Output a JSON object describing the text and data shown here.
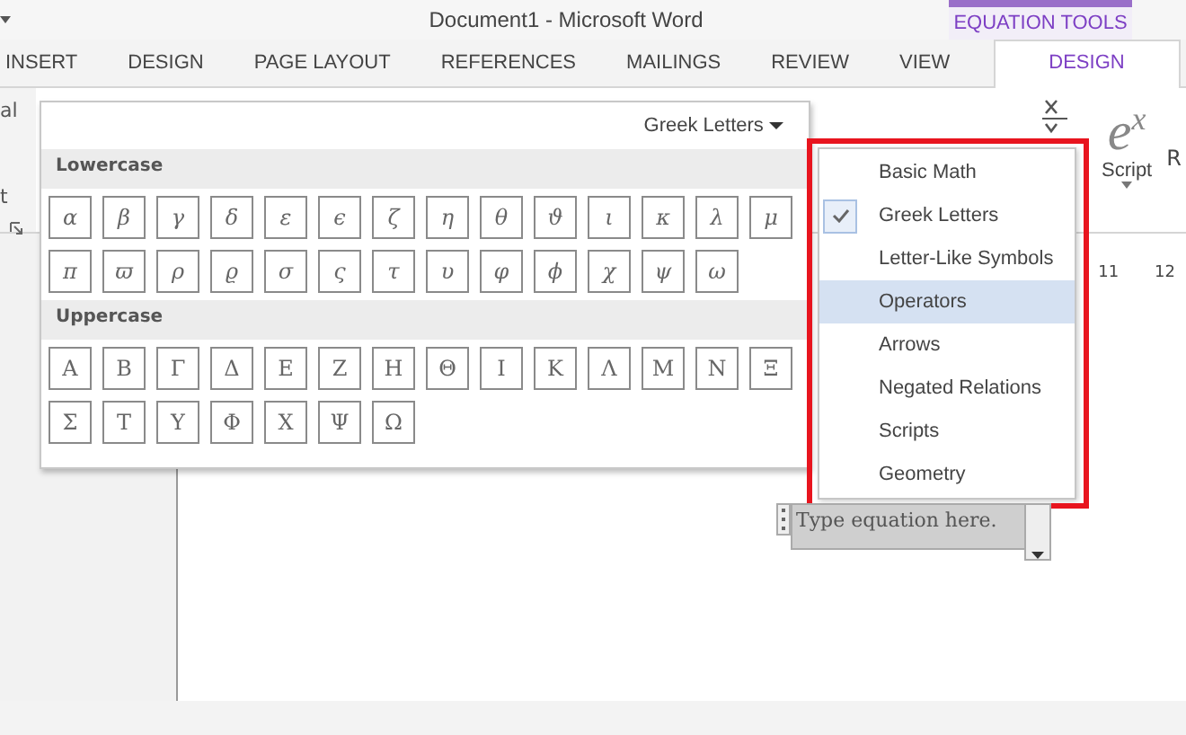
{
  "window": {
    "title": "Document1 - Microsoft Word",
    "context_tab_group": "EQUATION TOOLS"
  },
  "tabs": [
    {
      "label": "INSERT",
      "selected": false
    },
    {
      "label": "DESIGN",
      "selected": false
    },
    {
      "label": "PAGE LAYOUT",
      "selected": false
    },
    {
      "label": "REFERENCES",
      "selected": false
    },
    {
      "label": "MAILINGS",
      "selected": false
    },
    {
      "label": "REVIEW",
      "selected": false
    },
    {
      "label": "VIEW",
      "selected": false
    },
    {
      "label": "DESIGN",
      "selected": true
    }
  ],
  "ribbon": {
    "left_cut_labels": [
      "al",
      "t"
    ],
    "script_button": {
      "symbol": "e$^{x}$",
      "label": "Script"
    },
    "cut_label": "R",
    "ruler": [
      "11",
      "12"
    ]
  },
  "gallery": {
    "category": "Greek Letters",
    "sections": [
      {
        "title": "Lowercase",
        "symbols": [
          "α",
          "β",
          "γ",
          "δ",
          "ε",
          "ϵ",
          "ζ",
          "η",
          "θ",
          "ϑ",
          "ι",
          "κ",
          "λ",
          "μ",
          "π",
          "ϖ",
          "ρ",
          "ϱ",
          "σ",
          "ς",
          "τ",
          "υ",
          "φ",
          "ϕ",
          "χ",
          "ψ",
          "ω"
        ]
      },
      {
        "title": "Uppercase",
        "symbols": [
          "Α",
          "Β",
          "Γ",
          "Δ",
          "Ε",
          "Ζ",
          "Η",
          "Θ",
          "Ι",
          "Κ",
          "Λ",
          "Μ",
          "Ν",
          "Ξ",
          "Σ",
          "Τ",
          "Υ",
          "Φ",
          "Χ",
          "Ψ",
          "Ω"
        ]
      }
    ]
  },
  "category_menu": {
    "items": [
      {
        "label": "Basic Math",
        "checked": false,
        "selected": false
      },
      {
        "label": "Greek Letters",
        "checked": true,
        "selected": false
      },
      {
        "label": "Letter-Like Symbols",
        "checked": false,
        "selected": false
      },
      {
        "label": "Operators",
        "checked": false,
        "selected": true
      },
      {
        "label": "Arrows",
        "checked": false,
        "selected": false
      },
      {
        "label": "Negated Relations",
        "checked": false,
        "selected": false
      },
      {
        "label": "Scripts",
        "checked": false,
        "selected": false
      },
      {
        "label": "Geometry",
        "checked": false,
        "selected": false
      }
    ]
  },
  "equation": {
    "placeholder": "Type equation here."
  }
}
